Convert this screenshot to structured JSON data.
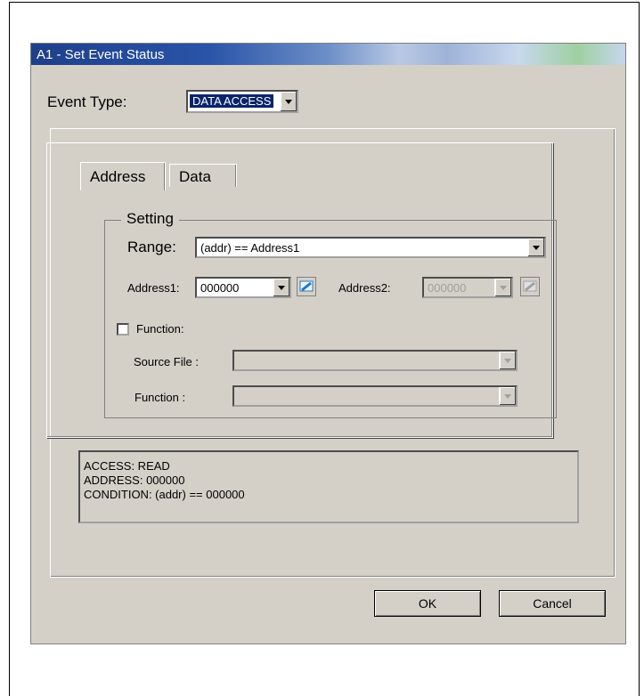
{
  "dialog": {
    "title": "A1 - Set Event Status",
    "event_type_label": "Event Type:",
    "event_type_value": "DATA ACCESS",
    "tabs": [
      {
        "label": "Address",
        "active": true
      },
      {
        "label": "Data",
        "active": false
      }
    ],
    "setting_legend": "Setting",
    "range_label": "Range:",
    "range_value": "(addr) == Address1",
    "address1_label": "Address1:",
    "address1_value": "000000",
    "address2_label": "Address2:",
    "address2_value": "000000",
    "function_checkbox_label": "Function:",
    "function_checked": false,
    "source_file_label": "Source File :",
    "function_label": "Function :",
    "summary_lines": [
      "ACCESS: READ",
      "ADDRESS: 000000",
      "CONDITION: (addr)  == 000000"
    ],
    "ok_label": "OK",
    "cancel_label": "Cancel"
  },
  "colors": {
    "dialog_bg": "#d4d0c8",
    "title_start": "#1e3f8a",
    "title_text": "#ffffff"
  },
  "icons": [
    "dropdown-arrow-icon",
    "address-browse-icon",
    "pointer-arrow-icon"
  ]
}
